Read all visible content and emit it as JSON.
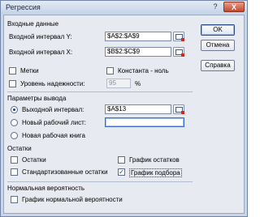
{
  "window": {
    "title": "Регрессия",
    "help_glyph": "?",
    "close_glyph": "X"
  },
  "buttons": {
    "ok": "OK",
    "cancel": "Отмена",
    "help": "Справка"
  },
  "input": {
    "group_title": "Входные данные",
    "y_label": "Входной интервал Y:",
    "y_value": "$A$2:$A$9",
    "x_label": "Входной интервал X:",
    "x_value": "$B$2:$C$9",
    "labels_label": "Метки",
    "labels_checked": false,
    "constant_zero_label": "Константа - ноль",
    "constant_zero_checked": false,
    "confidence_label": "Уровень надежности:",
    "confidence_checked": false,
    "confidence_value": "95",
    "percent": "%"
  },
  "output": {
    "group_title": "Параметры вывода",
    "output_range_label": "Выходной интервал:",
    "output_range_value": "$A$13",
    "new_sheet_label": "Новый рабочий лист:",
    "new_sheet_value": "",
    "new_book_label": "Новая рабочая книга",
    "selected": "output_range"
  },
  "residuals": {
    "group_title": "Остатки",
    "residuals_label": "Остатки",
    "residuals_checked": false,
    "standardized_label": "Стандартизованные остатки",
    "standardized_checked": false,
    "residual_plots_label": "График остатков",
    "residual_plots_checked": false,
    "line_fit_label": "График подбора",
    "line_fit_checked": true
  },
  "normal": {
    "group_title": "Нормальная вероятность",
    "normal_plot_label": "График нормальной вероятности",
    "normal_plot_checked": false
  },
  "check_glyph": "✓"
}
